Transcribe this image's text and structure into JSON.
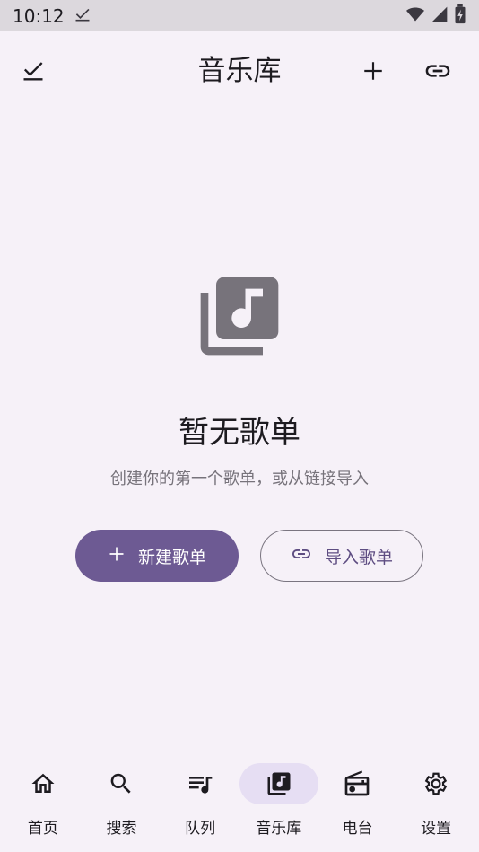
{
  "status_bar": {
    "time": "10:12",
    "icons": [
      "download-done-icon",
      "wifi-icon",
      "signal-icon",
      "battery-icon"
    ]
  },
  "app_bar": {
    "title": "音乐库",
    "left_icon": "select-check-icon",
    "right_icons": [
      "add-icon",
      "link-icon"
    ]
  },
  "empty_state": {
    "icon": "library-music-icon",
    "title": "暂无歌单",
    "subtitle": "创建你的第一个歌单，或从链接导入"
  },
  "actions": {
    "create_label": "新建歌单",
    "import_label": "导入歌单"
  },
  "nav": {
    "items": [
      {
        "label": "首页",
        "icon": "home-icon"
      },
      {
        "label": "搜索",
        "icon": "search-icon"
      },
      {
        "label": "队列",
        "icon": "queue-music-icon"
      },
      {
        "label": "音乐库",
        "icon": "library-music-icon",
        "active": true
      },
      {
        "label": "电台",
        "icon": "radio-icon"
      },
      {
        "label": "设置",
        "icon": "settings-icon"
      }
    ]
  },
  "colors": {
    "background": "#f6f1f8",
    "primary": "#6d5a93",
    "nav_active_pill": "#e6def3",
    "secondary_text": "#77737b"
  }
}
